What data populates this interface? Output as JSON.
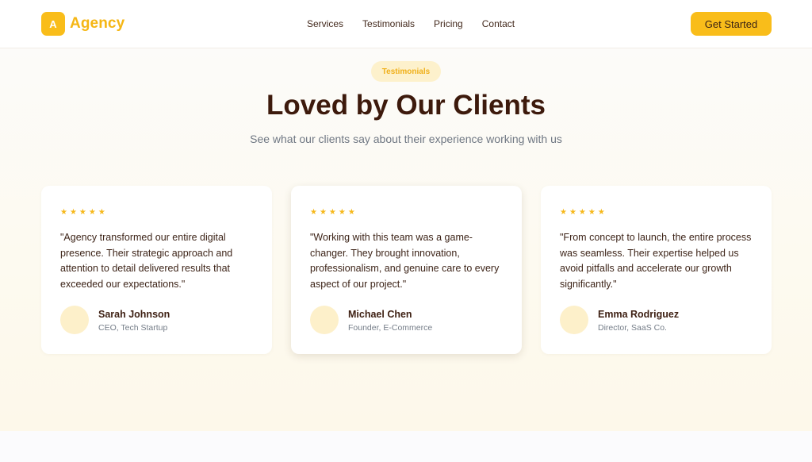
{
  "nav": {
    "logo_letter": "A",
    "brand": "Agency",
    "links": [
      "Services",
      "Testimonials",
      "Pricing",
      "Contact"
    ],
    "cta": "Get Started"
  },
  "section": {
    "badge": "Testimonials",
    "title": "Loved by Our Clients",
    "subtitle": "See what our clients say about their experience working with us"
  },
  "testimonials": [
    {
      "stars": "★★★★★",
      "rating": 5,
      "quote": "\"Agency transformed our entire digital presence. Their strategic approach and attention to detail delivered results that exceeded our expectations.\"",
      "name": "Sarah Johnson",
      "role": "CEO, Tech Startup"
    },
    {
      "stars": "★★★★★",
      "rating": 5,
      "quote": "\"Working with this team was a game-changer. They brought innovation, professionalism, and genuine care to every aspect of our project.\"",
      "name": "Michael Chen",
      "role": "Founder, E-Commerce"
    },
    {
      "stars": "★★★★★",
      "rating": 5,
      "quote": "\"From concept to launch, the entire process was seamless. Their expertise helped us avoid pitfalls and accelerate our growth significantly.\"",
      "name": "Emma Rodriguez",
      "role": "Director, SaaS Co."
    }
  ],
  "colors": {
    "accent": "#f9bd1a",
    "heading": "#3d1a0c",
    "muted": "#6f7783"
  }
}
